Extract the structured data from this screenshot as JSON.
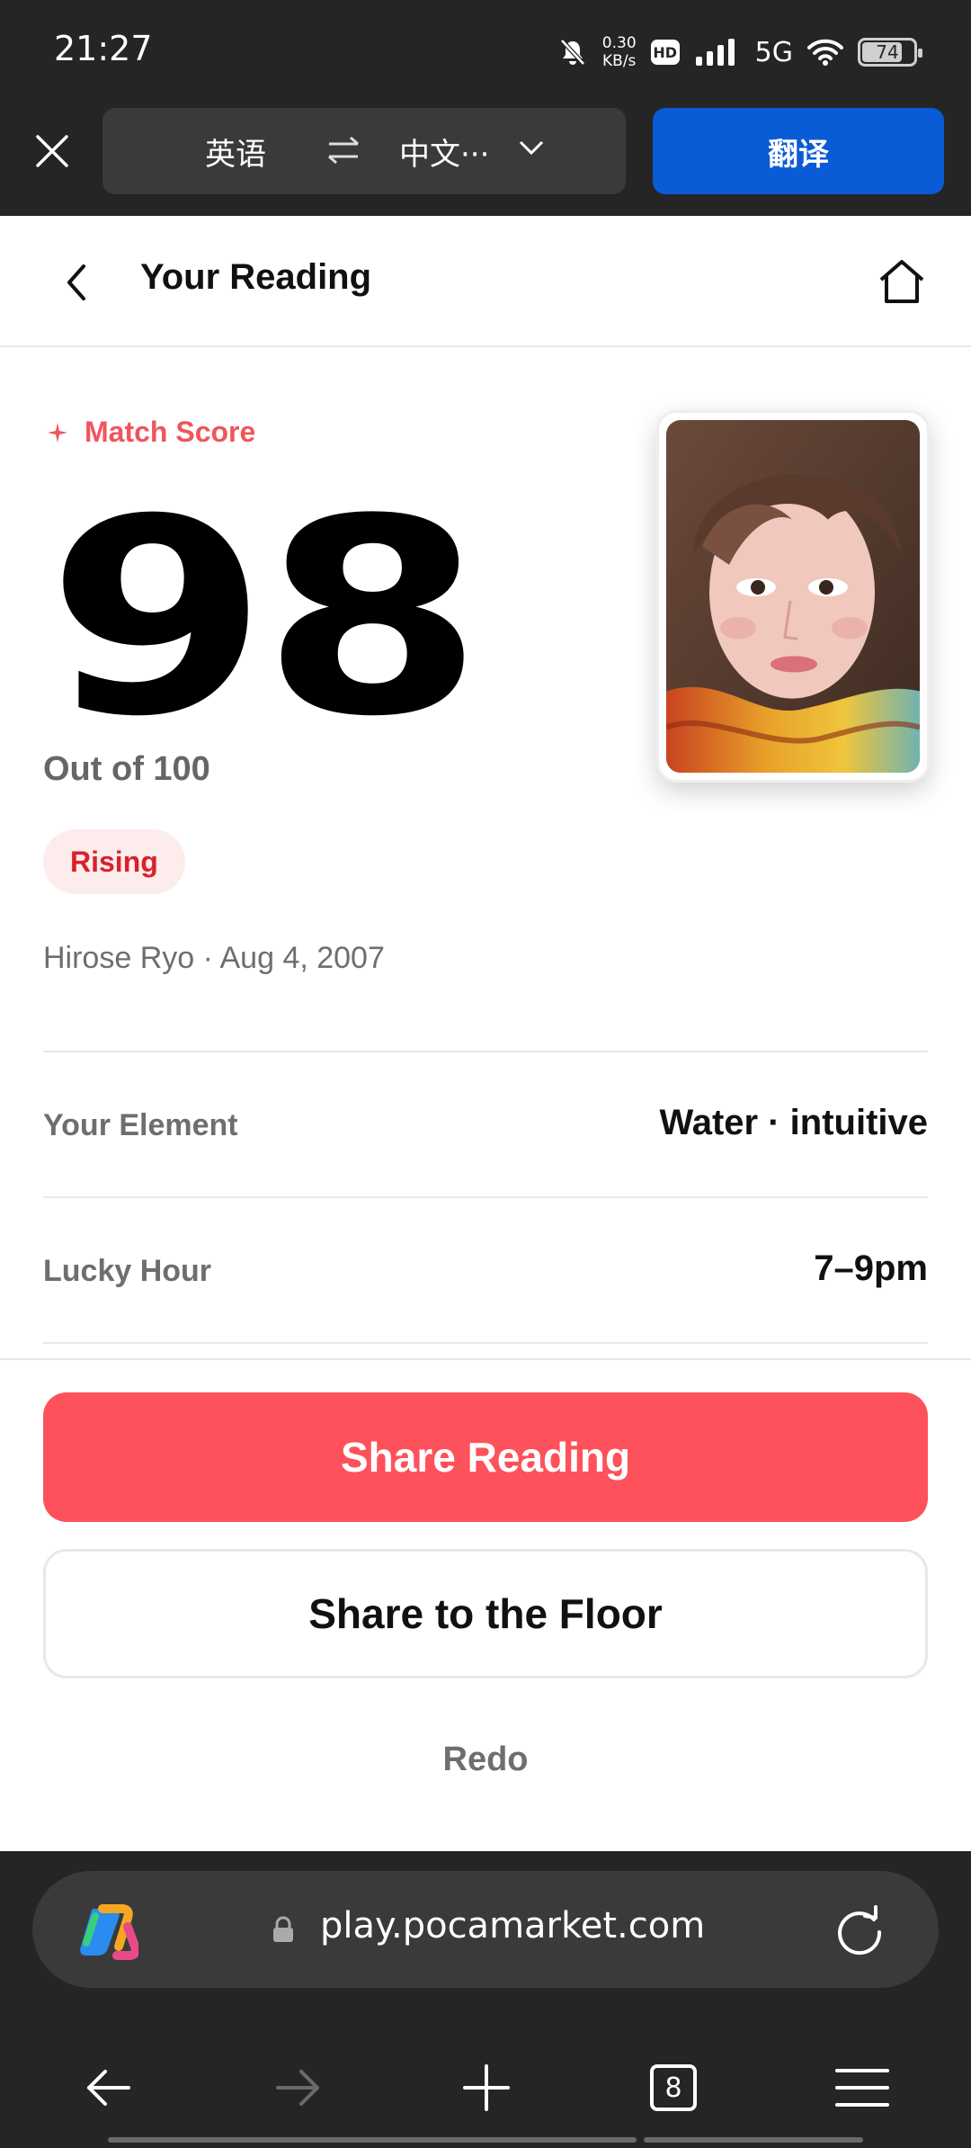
{
  "status_bar": {
    "time": "21:27",
    "net_speed_value": "0.30",
    "net_speed_unit": "KB/s",
    "hd_badge": "HD",
    "network": "5G",
    "battery": "74"
  },
  "translate_bar": {
    "source_lang": "英语",
    "target_lang": "中文···",
    "translate_button": "翻译"
  },
  "header": {
    "title": "Your Reading"
  },
  "reading": {
    "match_label": "Match Score",
    "score": "98",
    "out_of": "Out of 100",
    "status_badge": "Rising",
    "person_line": "Hirose Ryo · Aug 4, 2007",
    "details": [
      {
        "label": "Your Element",
        "value": "Water · intuitive"
      },
      {
        "label": "Lucky Hour",
        "value": "7–9pm"
      }
    ]
  },
  "actions": {
    "primary": "Share Reading",
    "secondary": "Share to the Floor",
    "tertiary": "Redo"
  },
  "browser": {
    "url": "play.pocamarket.com",
    "tab_count": "8"
  },
  "colors": {
    "accent": "#fd525b",
    "badge_text": "#d9212b",
    "translate_blue": "#0a5bd6",
    "chrome_dark": "#252526"
  }
}
